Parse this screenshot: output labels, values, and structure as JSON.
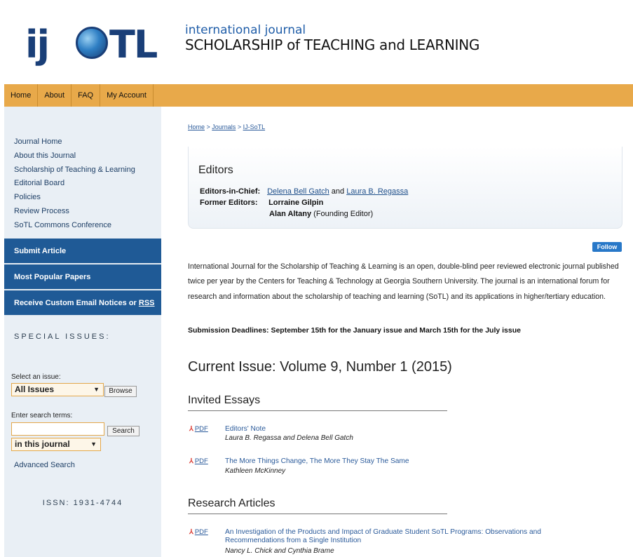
{
  "header": {
    "logo_text": "ijSOTL",
    "subtitle_line1": "international journal",
    "subtitle_line2": "SCHOLARSHIP of TEACHING and LEARNING"
  },
  "nav": {
    "items": [
      "Home",
      "About",
      "FAQ",
      "My Account"
    ]
  },
  "sidebar": {
    "links": [
      "Journal Home",
      "About this Journal",
      "Scholarship of Teaching & Learning",
      "Editorial Board",
      "Policies",
      "Review Process",
      "SoTL Commons Conference"
    ],
    "submit_article": "Submit Article",
    "most_popular": "Most Popular Papers",
    "notices_text": "Receive Custom Email Notices or ",
    "notices_rss": "RSS",
    "special_issues": "SPECIAL ISSUES:",
    "select_label": "Select an issue:",
    "issue_select_value": "All Issues",
    "browse_label": "Browse",
    "search_label": "Enter search terms:",
    "search_button": "Search",
    "scope_select_value": "in this journal",
    "advanced_search": "Advanced Search",
    "issn": "ISSN: 1931-4744"
  },
  "breadcrumb": [
    "Home",
    "Journals",
    "IJ-SoTL"
  ],
  "editors": {
    "title": "Editors",
    "chief_label": "Editors-in-Chief:",
    "chief_1": "Delena Bell Gatch",
    "and": " and ",
    "chief_2": "Laura B. Regassa",
    "former_label": "Former Editors:",
    "former_1": "Lorraine Gilpin",
    "former_2": "Alan Altany",
    "former_2_note": " (Founding Editor)"
  },
  "follow_label": "Follow",
  "description": "International Journal for the Scholarship of Teaching & Learning is an open, double-blind peer reviewed electronic journal published twice per year by the Centers for Teaching & Technology at Georgia Southern University. The journal is an international forum for research and information about the scholarship of teaching and learning (SoTL) and its applications in higher/tertiary education.",
  "deadlines": "Submission Deadlines: September 15th for the January issue and March 15th for the July issue",
  "current_issue": "Current Issue: Volume 9, Number 1 (2015)",
  "sections": {
    "invited": "Invited Essays",
    "research": "Research Articles"
  },
  "articles": [
    {
      "pdf": "PDF",
      "title": "Editors' Note",
      "authors": "Laura B. Regassa and Delena Bell Gatch"
    },
    {
      "pdf": "PDF",
      "title": "The More Things Change, The More They Stay The Same",
      "authors": "Kathleen McKinney"
    },
    {
      "pdf": "PDF",
      "title": "An Investigation of the Products and Impact of Graduate Student SoTL Programs: Observations and Recommendations from a Single Institution",
      "authors": "Nancy L. Chick and Cynthia Brame"
    }
  ],
  "colors": {
    "nav_bar": "#e8a94a",
    "sidebar_bg": "#e9eff5",
    "sidebar_button": "#1f5a96",
    "link": "#2a5a9a",
    "logo": "#1a3f78"
  }
}
